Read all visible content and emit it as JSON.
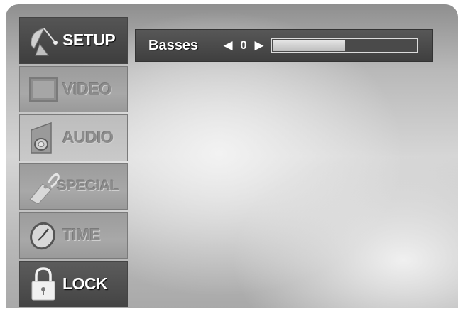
{
  "menu": {
    "items": [
      {
        "label": "SETUP",
        "icon": "satellite-dish-icon",
        "active": true
      },
      {
        "label": "VIDEO",
        "icon": "tv-screen-icon",
        "active": false
      },
      {
        "label": "AUDIO",
        "icon": "speaker-icon",
        "active": false
      },
      {
        "label": "SPECIAL",
        "icon": "tag-icon",
        "active": false
      },
      {
        "label": "TIME",
        "icon": "clock-icon",
        "active": false
      },
      {
        "label": "LOCK",
        "icon": "padlock-icon",
        "active": false
      }
    ]
  },
  "setting": {
    "label": "Basses",
    "value": "0",
    "left_arrow": "◀",
    "right_arrow": "▶",
    "level_fraction": 0.5
  },
  "colors": {
    "active_item": "#4a4a4a",
    "bar": "#4a4a4a"
  }
}
